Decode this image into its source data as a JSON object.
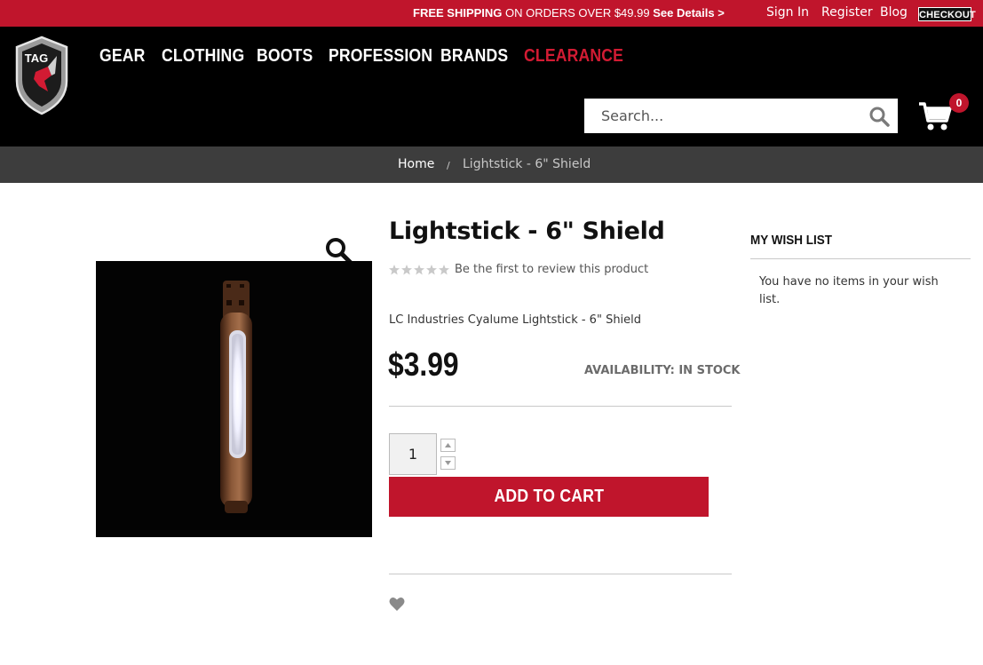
{
  "promo": {
    "bold": "FREE SHIPPING",
    "text": " ON ORDERS OVER $49.99 ",
    "link": "See Details >"
  },
  "top_links": {
    "sign_in": "Sign In",
    "register": "Register",
    "blog": "Blog",
    "checkout": "CHECKOUT"
  },
  "logo": {
    "text": "TAG"
  },
  "nav": {
    "items": [
      "GEAR",
      "CLOTHING",
      "BOOTS",
      "PROFESSION",
      "BRANDS",
      "CLEARANCE"
    ]
  },
  "search": {
    "placeholder": "Search..."
  },
  "cart": {
    "count": "0"
  },
  "breadcrumb": {
    "home": "Home",
    "separator": "/",
    "current": "Lightstick - 6\" Shield"
  },
  "product": {
    "title": "Lightstick - 6\" Shield",
    "rating": 0,
    "review_link": "Be the first to review this product",
    "short_description": "LC Industries Cyalume Lightstick - 6\" Shield",
    "price": "$3.99",
    "availability": "AVAILABILITY: IN STOCK",
    "quantity": "1",
    "add_to_cart": "ADD TO CART"
  },
  "wishlist": {
    "title": "MY WISH LIST",
    "empty_text": "You have no items in your wish list."
  },
  "colors": {
    "brand_red": "#c0152c",
    "header_bg": "#000000",
    "breadcrumb_bg": "#3d3d3d"
  }
}
